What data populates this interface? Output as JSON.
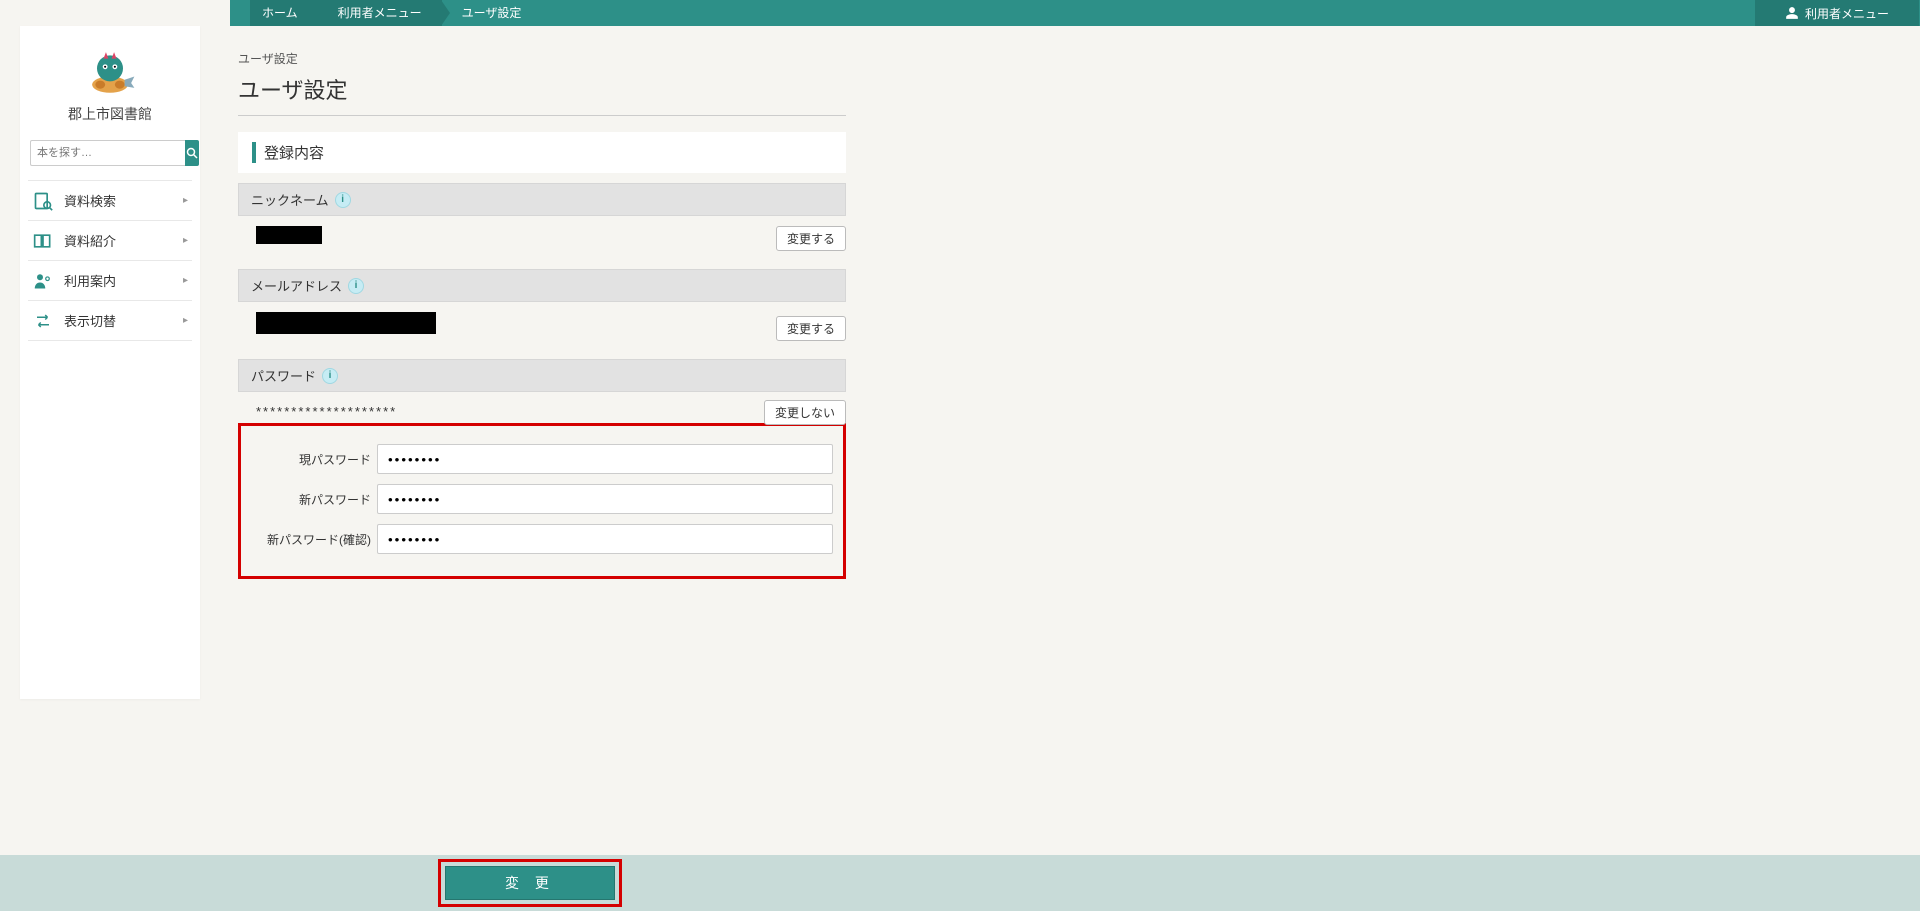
{
  "breadcrumb": {
    "home": "ホーム",
    "user_menu": "利用者メニュー",
    "user_settings": "ユーザ設定"
  },
  "topbar": {
    "user_menu": "利用者メニュー"
  },
  "sidebar": {
    "site_title": "郡上市図書館",
    "search_placeholder": "本を探す…",
    "items": [
      {
        "label": "資料検索"
      },
      {
        "label": "資料紹介"
      },
      {
        "label": "利用案内"
      },
      {
        "label": "表示切替"
      }
    ]
  },
  "main": {
    "mini_crumb": "ユーザ設定",
    "page_title": "ユーザ設定",
    "panel_title": "登録内容",
    "sections": {
      "nickname": {
        "title": "ニックネーム",
        "change_btn": "変更する"
      },
      "email": {
        "title": "メールアドレス",
        "change_btn": "変更する"
      },
      "password": {
        "title": "パスワード",
        "not_change_btn": "変更しない",
        "masked": "********************",
        "current_label": "現パスワード",
        "new_label": "新パスワード",
        "confirm_label": "新パスワード(確認)",
        "current_value": "••••••••",
        "new_value": "••••••••",
        "confirm_value": "••••••••"
      }
    },
    "submit": "変 更"
  }
}
